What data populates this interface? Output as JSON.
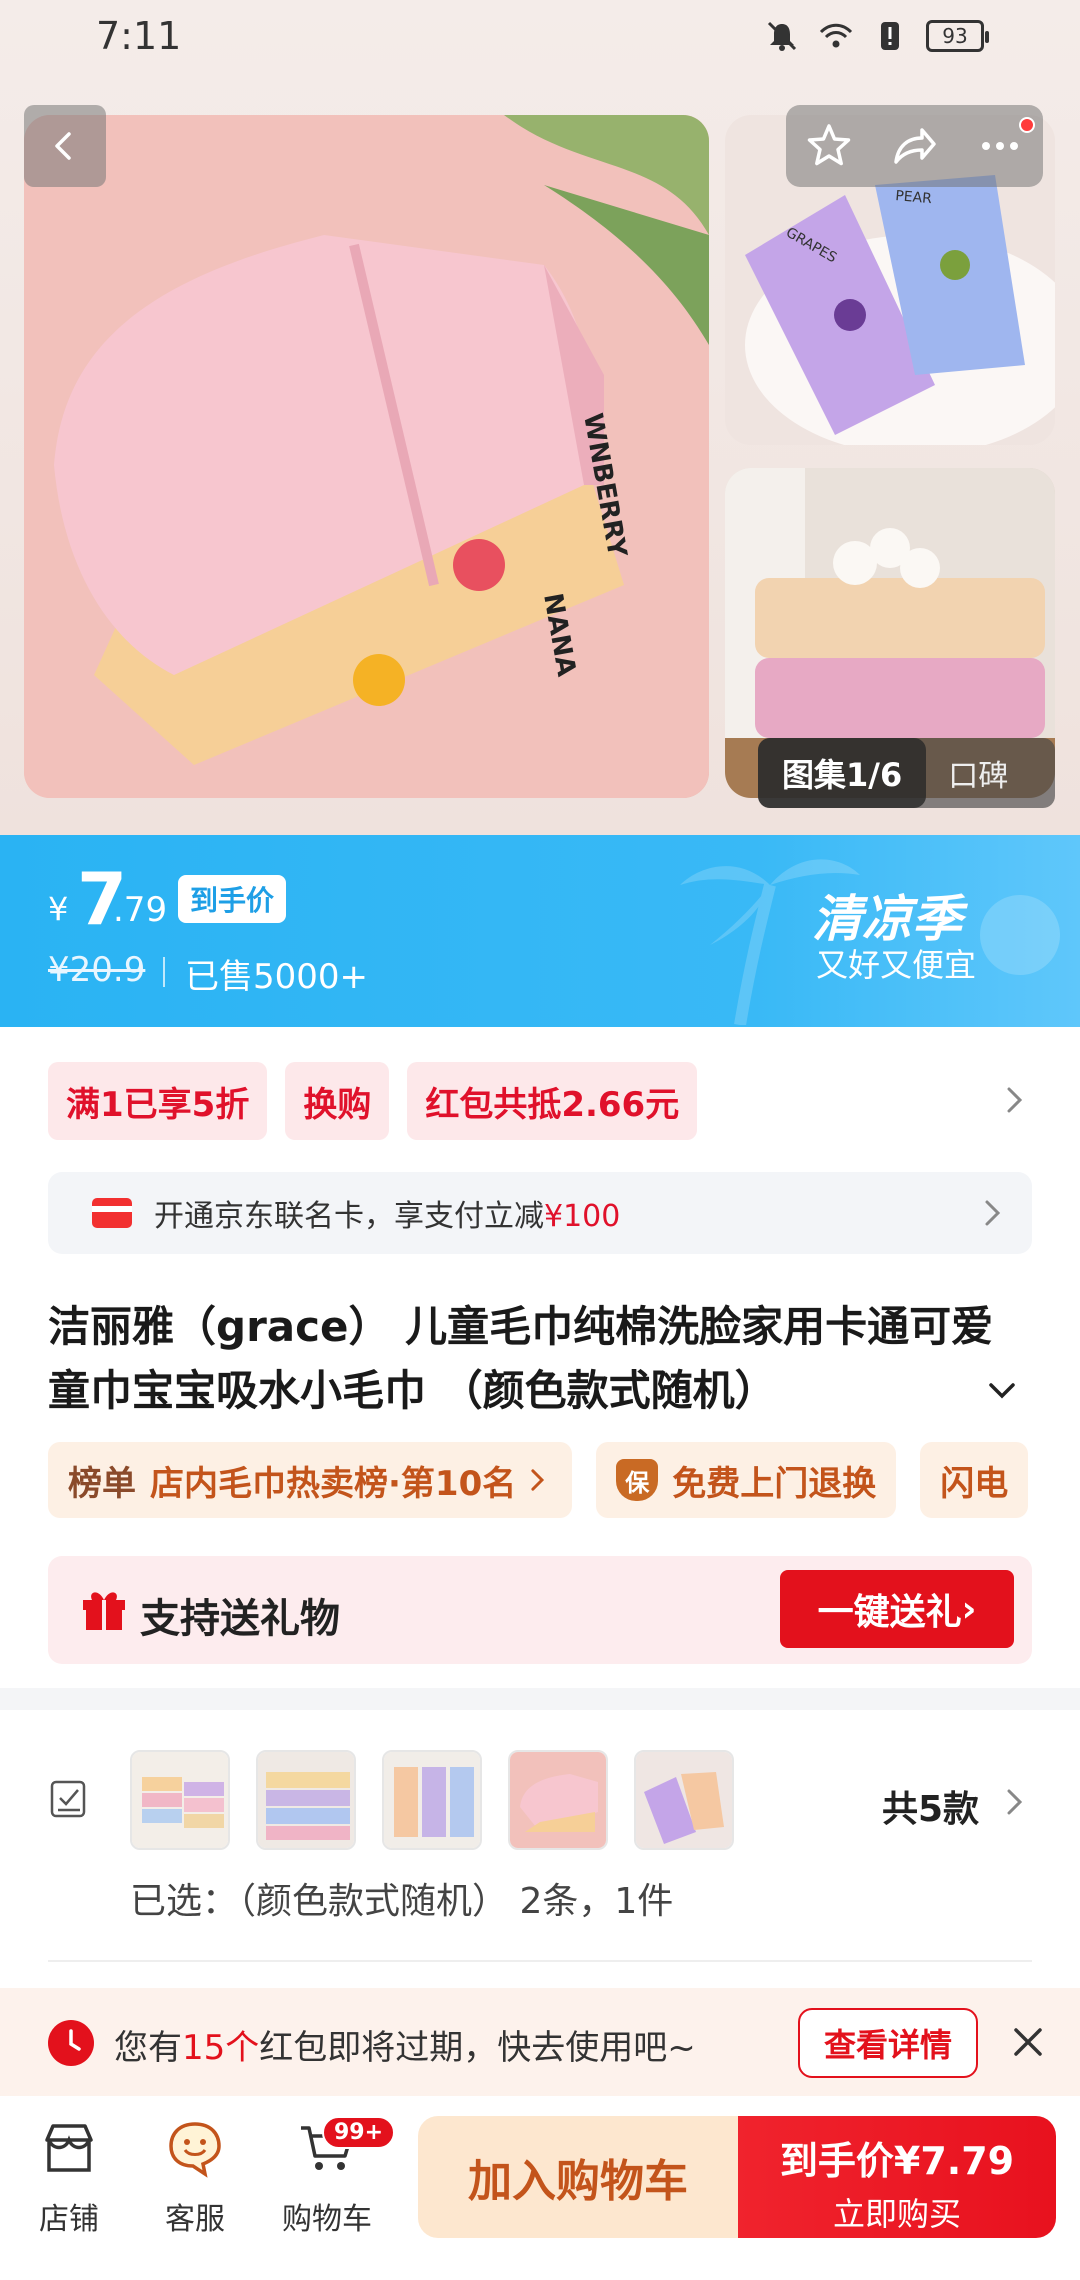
{
  "status_bar": {
    "time": "7:11",
    "battery": "93"
  },
  "gallery": {
    "indicator": "图集1/6",
    "reviews_tab": "口碑",
    "main_image_text": "WNBERRY",
    "main_image_text2": "NANA",
    "side1_text1": "GRAPES",
    "side1_text2": "PEAR"
  },
  "price": {
    "yen": "¥",
    "integer": "7",
    "decimal": ".79",
    "tag": "到手价",
    "original": "¥20.9",
    "sold": "已售5000+",
    "season": "清凉季",
    "season_sub": "又好又便宜"
  },
  "promos": [
    "满1已享5折",
    "换购",
    "红包共抵2.66元"
  ],
  "card_offer": {
    "text": "开通京东联名卡，享支付立减",
    "amount": "¥100"
  },
  "title": "洁丽雅（grace） 儿童毛巾纯棉洗脸家用卡通可爱童巾宝宝吸水小毛巾 （颜色款式随机）",
  "tags": {
    "rank_key": "榜单",
    "rank_text": "店内毛巾热卖榜·第10名",
    "return_icon": "保",
    "return_text": "免费上门退换",
    "flash_text": "闪电"
  },
  "gift": {
    "label": "支持送礼物",
    "button": "一键送礼"
  },
  "variants": {
    "count": "共5款",
    "selected": "已选：（颜色款式随机） 2条，1件"
  },
  "notice": {
    "prefix": "您有",
    "count": "15个",
    "suffix": "红包即将过期，快去使用吧~",
    "button": "查看详情"
  },
  "bottom_bar": {
    "store": "店铺",
    "service": "客服",
    "cart": "购物车",
    "cart_badge": "99+",
    "add_cart": "加入购物车",
    "buy_price_label": "到手价",
    "buy_price": "¥7.79",
    "buy_now": "立即购买"
  },
  "colors": {
    "accent_red": "#e3111c",
    "price_blue": "#2ab3f3",
    "tag_orange": "#c3541b"
  }
}
